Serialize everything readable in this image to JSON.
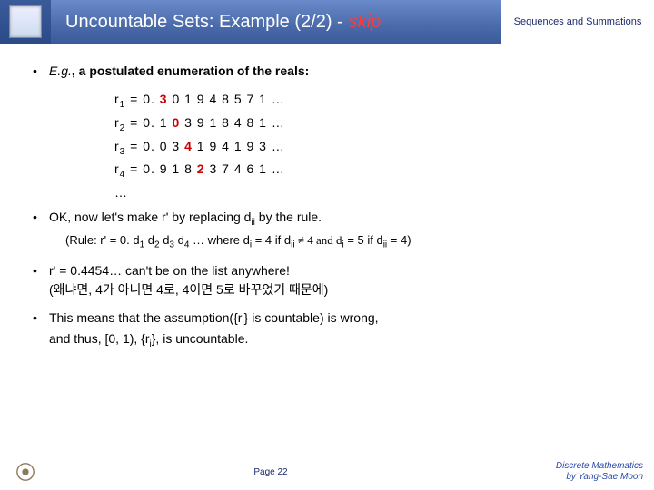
{
  "header": {
    "title_main": "Uncountable Sets: Example (2/2) -",
    "title_skip": "skip",
    "section": "Sequences and Summations"
  },
  "bullets": {
    "b1_prefix": "E.g.",
    "b1_rest": ", a postulated enumeration of the reals:",
    "b2": "OK, now let's make r' by replacing d",
    "b2_suffix": " by the rule.",
    "rule_text": "(Rule: r' = 0. d",
    "rule_mid": " … where d",
    "rule_cond1": " = 4 if d",
    "rule_cond2": " ≠ 4 and d",
    "rule_cond3": " = 5 if d",
    "rule_end": " = 4)",
    "b3_a": "r' = 0.4454… can't be on the list anywhere!",
    "b3_b": "(왜냐면, 4가 아니면 4로, 4이면 5로 바꾸었기 때문에)",
    "b4_a": "This means that the assumption({r",
    "b4_b": "} is countable) is wrong,",
    "b4_c": "and thus, [0, 1), {r",
    "b4_d": "}, is uncountable."
  },
  "enum": {
    "r1": {
      "label": "r",
      "sub": "1",
      "eq": " = 0. ",
      "d": "3",
      "rest": " 0 1 9 4 8 5 7 1 …"
    },
    "r2": {
      "label": "r",
      "sub": "2",
      "eq": " = 0. 1 ",
      "d": "0",
      "rest": " 3 9 1 8 4 8 1 …"
    },
    "r3": {
      "label": "r",
      "sub": "3",
      "eq": " = 0. 0 3 ",
      "d": "4",
      "rest": " 1 9 4 1 9 3 …"
    },
    "r4": {
      "label": "r",
      "sub": "4",
      "eq": " = 0. 9 1 8 ",
      "d": "2",
      "rest": " 3 7 4 6 1 …"
    },
    "dots": "…"
  },
  "footer": {
    "page": "Page 22",
    "credit1": "Discrete Mathematics",
    "credit2": "by Yang-Sae Moon"
  },
  "subs": {
    "ii": "ii",
    "i": "i",
    "1": "1",
    "2": "2",
    "3": "3",
    "4": "4"
  }
}
